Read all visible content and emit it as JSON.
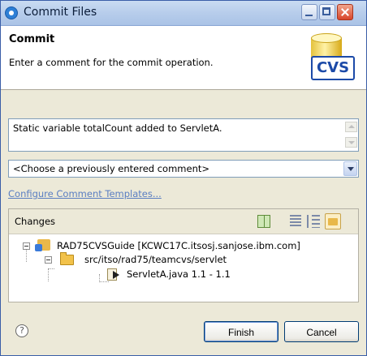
{
  "window": {
    "title": "Commit Files"
  },
  "header": {
    "title": "Commit",
    "message": "Enter a comment for the commit operation.",
    "logo_text": "CVS"
  },
  "comment": {
    "value": "Static variable totalCount added to ServletA.",
    "previous_select": "<Choose a previously entered comment>"
  },
  "configure_link": "Configure Comment Templates...",
  "changes": {
    "title": "Changes",
    "tree": [
      {
        "label": "RAD75CVSGuide   [KCWC17C.itsosj.sanjose.ibm.com]",
        "icon": "project-icon"
      },
      {
        "label": "src/itso/rad75/teamcvs/servlet",
        "icon": "folder-icon"
      },
      {
        "label": "ServletA.java  1.1 - 1.1",
        "icon": "java-file-icon"
      }
    ]
  },
  "buttons": {
    "finish": "Finish",
    "cancel": "Cancel",
    "help": "?"
  },
  "colors": {
    "accent": "#3a5ea8",
    "link": "#5a7ec2",
    "dialog_bg": "#ece9d8"
  }
}
